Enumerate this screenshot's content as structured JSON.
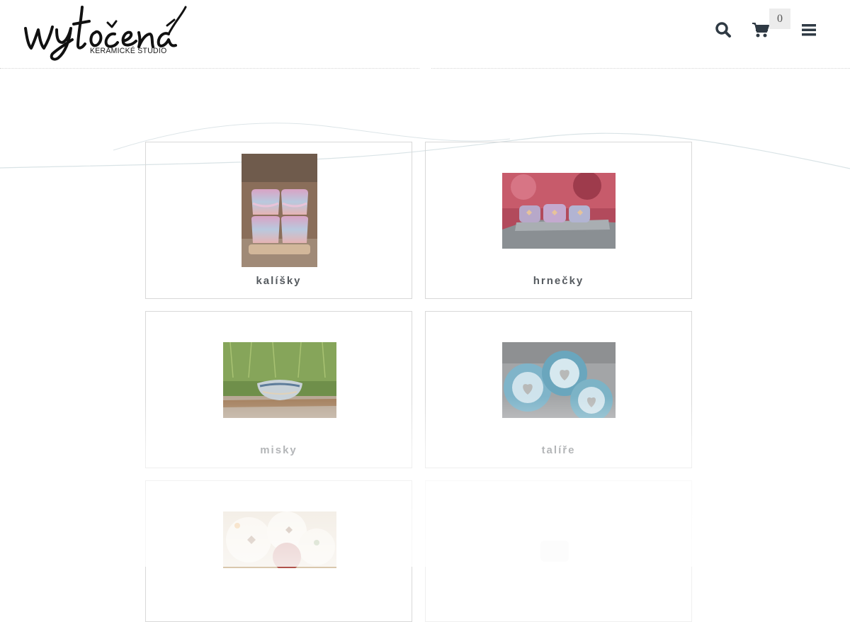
{
  "header": {
    "logo_text": "wytočená",
    "logo_subtitle": "KERAMICKÉ STUDIO",
    "cart_count": "0",
    "icons": {
      "search": "search-icon",
      "cart": "cart-icon",
      "menu": "hamburger-menu-icon"
    }
  },
  "categories": [
    {
      "label": "kalíšky",
      "image": "cups-photo"
    },
    {
      "label": "hrnečky",
      "image": "mugs-photo"
    },
    {
      "label": "misky",
      "image": "bowls-photo"
    },
    {
      "label": "talíře",
      "image": "plates-photo"
    },
    {
      "label": "",
      "image": "candles-photo"
    },
    {
      "label": "",
      "image": "faded-photo"
    }
  ],
  "colors": {
    "icon": "#2f3a44",
    "label": "#555a5f",
    "border": "#d8d8d8"
  }
}
